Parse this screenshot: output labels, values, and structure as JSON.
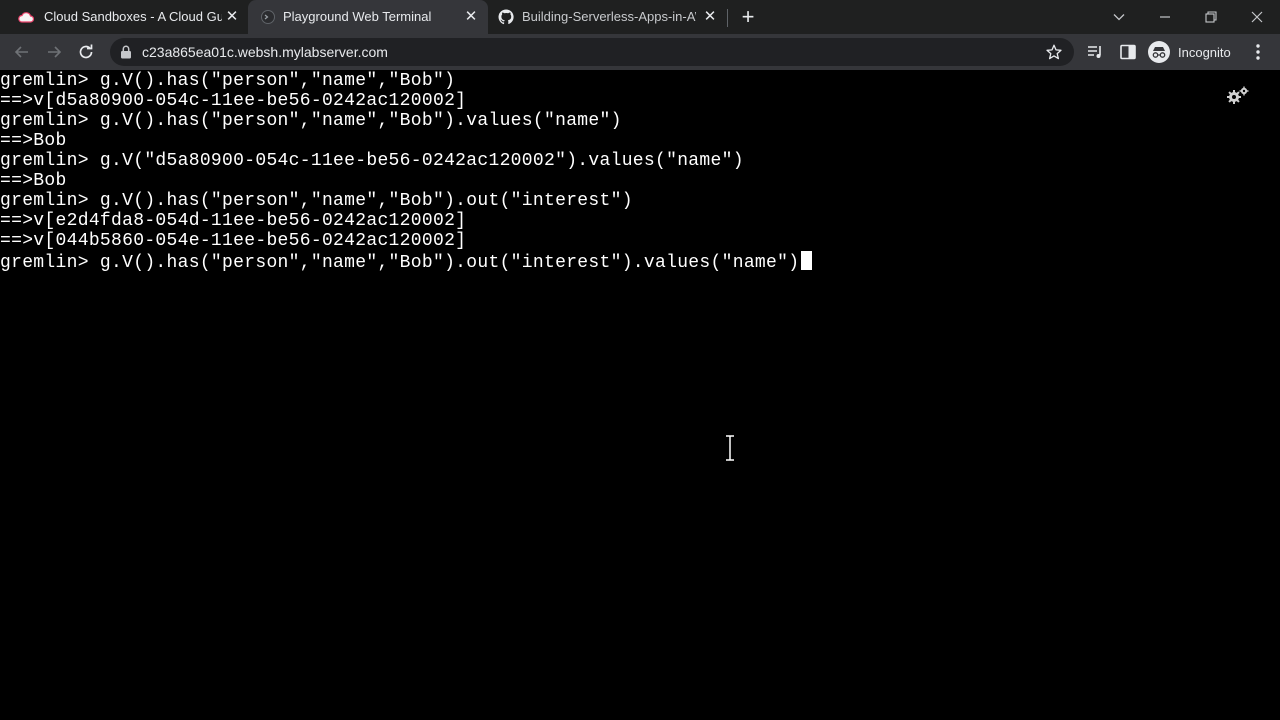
{
  "browser": {
    "tabs": [
      {
        "title": "Cloud Sandboxes - A Cloud Guru",
        "favicon": "cloud-icon",
        "active": false
      },
      {
        "title": "Playground Web Terminal",
        "favicon": "terminal-globe-icon",
        "active": true
      },
      {
        "title": "Building-Serverless-Apps-in-AWS",
        "favicon": "github-icon",
        "active": false
      }
    ],
    "url": "c23a865ea01c.websh.mylabserver.com",
    "profile_label": "Incognito"
  },
  "terminal": {
    "lines": [
      "gremlin> g.V().has(\"person\",\"name\",\"Bob\")",
      "==>v[d5a80900-054c-11ee-be56-0242ac120002]",
      "gremlin> g.V().has(\"person\",\"name\",\"Bob\").values(\"name\")",
      "==>Bob",
      "gremlin> g.V(\"d5a80900-054c-11ee-be56-0242ac120002\").values(\"name\")",
      "==>Bob",
      "gremlin> g.V().has(\"person\",\"name\",\"Bob\").out(\"interest\")",
      "==>v[e2d4fda8-054d-11ee-be56-0242ac120002]",
      "==>v[044b5860-054e-11ee-be56-0242ac120002]"
    ],
    "current_input": "gremlin> g.V().has(\"person\",\"name\",\"Bob\").out(\"interest\").values(\"name\")"
  },
  "colors": {
    "tabstrip_bg": "#1f2020",
    "toolbar_bg": "#35363a",
    "omnibox_bg": "#202124",
    "terminal_bg": "#000000",
    "terminal_fg": "#ffffff"
  }
}
